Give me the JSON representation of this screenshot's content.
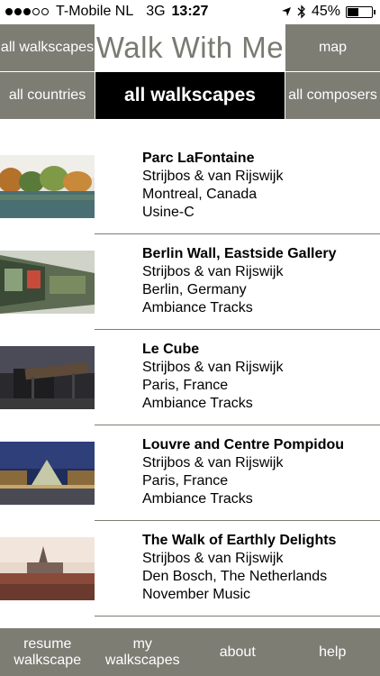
{
  "status": {
    "carrier": "T-Mobile NL",
    "network": "3G",
    "time": "13:27",
    "battery": "45%",
    "battery_level": 0.45,
    "signal_bars": 3,
    "signal_total": 5
  },
  "header": {
    "title": "Walk With Me",
    "left_button": "all walkscapes",
    "right_button": "map"
  },
  "filters": {
    "left": "all countries",
    "active": "all walkscapes",
    "right": "all composers"
  },
  "walkscapes": [
    {
      "name": "Parc LaFontaine",
      "artist": "Strijbos & van Rijswijk",
      "location": "Montreal, Canada",
      "label": "Usine-C"
    },
    {
      "name": "Berlin Wall, Eastside Gallery",
      "artist": "Strijbos & van Rijswijk",
      "location": "Berlin, Germany",
      "label": "Ambiance Tracks"
    },
    {
      "name": "Le Cube",
      "artist": "Strijbos & van Rijswijk",
      "location": "Paris, France",
      "label": "Ambiance Tracks"
    },
    {
      "name": "Louvre and Centre Pompidou",
      "artist": "Strijbos & van Rijswijk",
      "location": "Paris, France",
      "label": "Ambiance Tracks"
    },
    {
      "name": "The Walk of Earthly Delights",
      "artist": "Strijbos & van Rijswijk",
      "location": "Den Bosch, The Netherlands",
      "label": "November Music"
    }
  ],
  "bottom_nav": {
    "resume_line1": "resume",
    "resume_line2": "walkscape",
    "my_line1": "my",
    "my_line2": "walkscapes",
    "about": "about",
    "help": "help"
  },
  "colors": {
    "bar_gray": "#7d7d74",
    "active_tab": "#000000",
    "title_gray": "#7a7a72"
  }
}
